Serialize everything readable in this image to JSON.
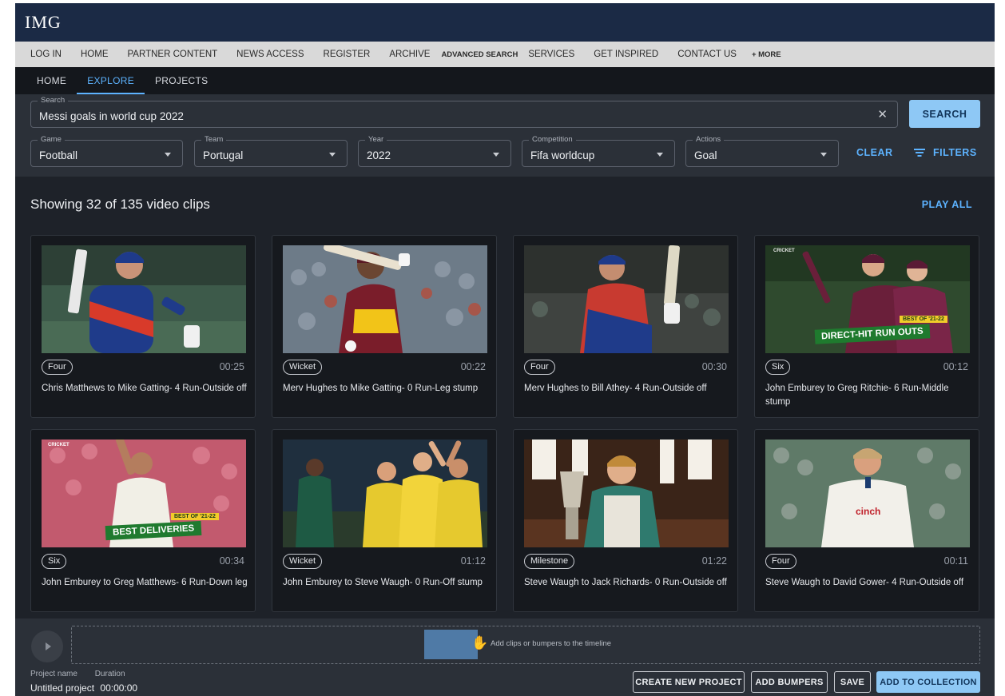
{
  "brand": {
    "logo": "IMG"
  },
  "topnav": {
    "items": [
      "LOG IN",
      "HOME",
      "PARTNER CONTENT",
      "NEWS ACCESS",
      "REGISTER",
      "ARCHIVE",
      "ADVANCED SEARCH",
      "SERVICES",
      "GET INSPIRED",
      "CONTACT US",
      "+ MORE"
    ]
  },
  "apptabs": {
    "items": [
      "HOME",
      "EXPLORE",
      "PROJECTS"
    ],
    "active": "EXPLORE"
  },
  "search": {
    "label": "Search",
    "value": "Messi goals in world cup 2022",
    "button": "SEARCH"
  },
  "filters": [
    {
      "label": "Game",
      "value": "Football"
    },
    {
      "label": "Team",
      "value": "Portugal"
    },
    {
      "label": "Year",
      "value": "2022"
    },
    {
      "label": "Competition",
      "value": "Fifa worldcup"
    },
    {
      "label": "Actions",
      "value": "Goal"
    }
  ],
  "actions": {
    "clear": "CLEAR",
    "filters": "FILTERS",
    "play_all": "PLAY ALL"
  },
  "results": {
    "heading": "Showing 32 of 135 video clips"
  },
  "clips": [
    {
      "tag": "Four",
      "duration": "00:25",
      "title": "Chris Matthews to Mike Gatting- 4 Run-Outside off"
    },
    {
      "tag": "Wicket",
      "duration": "00:22",
      "title": "Merv Hughes to Mike Gatting- 0 Run-Leg stump"
    },
    {
      "tag": "Four",
      "duration": "00:30",
      "title": "Merv Hughes to Bill Athey- 4 Run-Outside off"
    },
    {
      "tag": "Six",
      "duration": "00:12",
      "title": "John Emburey to Greg Ritchie- 6 Run-Middle stump",
      "overlay_top": "BEST OF '21-22",
      "overlay_main": "DIRECT-HIT RUN OUTS",
      "badge": "CRICKET"
    },
    {
      "tag": "Six",
      "duration": "00:34",
      "title": "John Emburey to Greg Matthews- 6 Run-Down leg",
      "overlay_top": "BEST OF '21-22",
      "overlay_main": "BEST DELIVERIES",
      "badge": "CRICKET"
    },
    {
      "tag": "Wicket",
      "duration": "01:12",
      "title": "John Emburey to Steve Waugh- 0 Run-Off stump"
    },
    {
      "tag": "Milestone",
      "duration": "01:22",
      "title": "Steve Waugh to Jack Richards- 0 Run-Outside off"
    },
    {
      "tag": "Four",
      "duration": "00:11",
      "title": "Steve Waugh to David Gower- 4 Run-Outside off",
      "shirt": "cinch"
    }
  ],
  "timeline": {
    "hint": "Add clips or bumpers to the timeline"
  },
  "project": {
    "name_label": "Project name",
    "duration_label": "Duration",
    "name": "Untitled project",
    "duration": "00:00:00"
  },
  "footer_buttons": {
    "create": "CREATE NEW PROJECT",
    "bumpers": "ADD BUMPERS",
    "save": "SAVE",
    "collection": "ADD TO COLLECTION"
  },
  "colors": {
    "accent": "#5db3ff",
    "primary_button": "#8ec8f5",
    "brand_bar": "#1b2a45"
  }
}
